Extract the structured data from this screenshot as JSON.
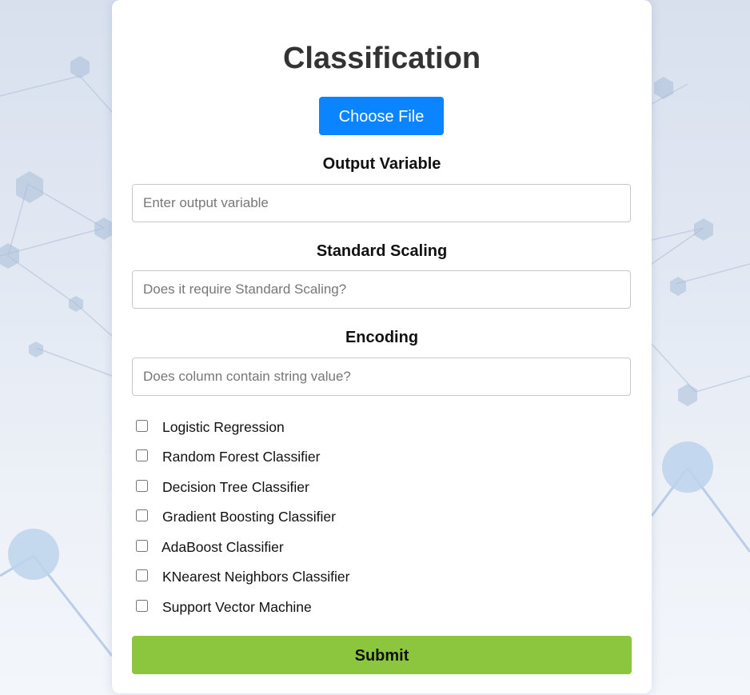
{
  "page": {
    "title": "Classification",
    "choose_file_label": "Choose File"
  },
  "form": {
    "output_variable": {
      "label": "Output Variable",
      "placeholder": "Enter output variable",
      "value": ""
    },
    "standard_scaling": {
      "label": "Standard Scaling",
      "placeholder": "Does it require Standard Scaling?",
      "value": ""
    },
    "encoding": {
      "label": "Encoding",
      "placeholder": "Does column contain string value?",
      "value": ""
    },
    "models": [
      {
        "label": "Logistic Regression",
        "checked": false
      },
      {
        "label": "Random Forest Classifier",
        "checked": false
      },
      {
        "label": "Decision Tree Classifier",
        "checked": false
      },
      {
        "label": "Gradient Boosting Classifier",
        "checked": false
      },
      {
        "label": "AdaBoost Classifier",
        "checked": false
      },
      {
        "label": "KNearest Neighbors Classifier",
        "checked": false
      },
      {
        "label": "Support Vector Machine",
        "checked": false
      }
    ],
    "submit_label": "Submit"
  },
  "colors": {
    "choose_button": "#0a84ff",
    "submit_button": "#8cc63f",
    "background": "#e4eaf4"
  }
}
